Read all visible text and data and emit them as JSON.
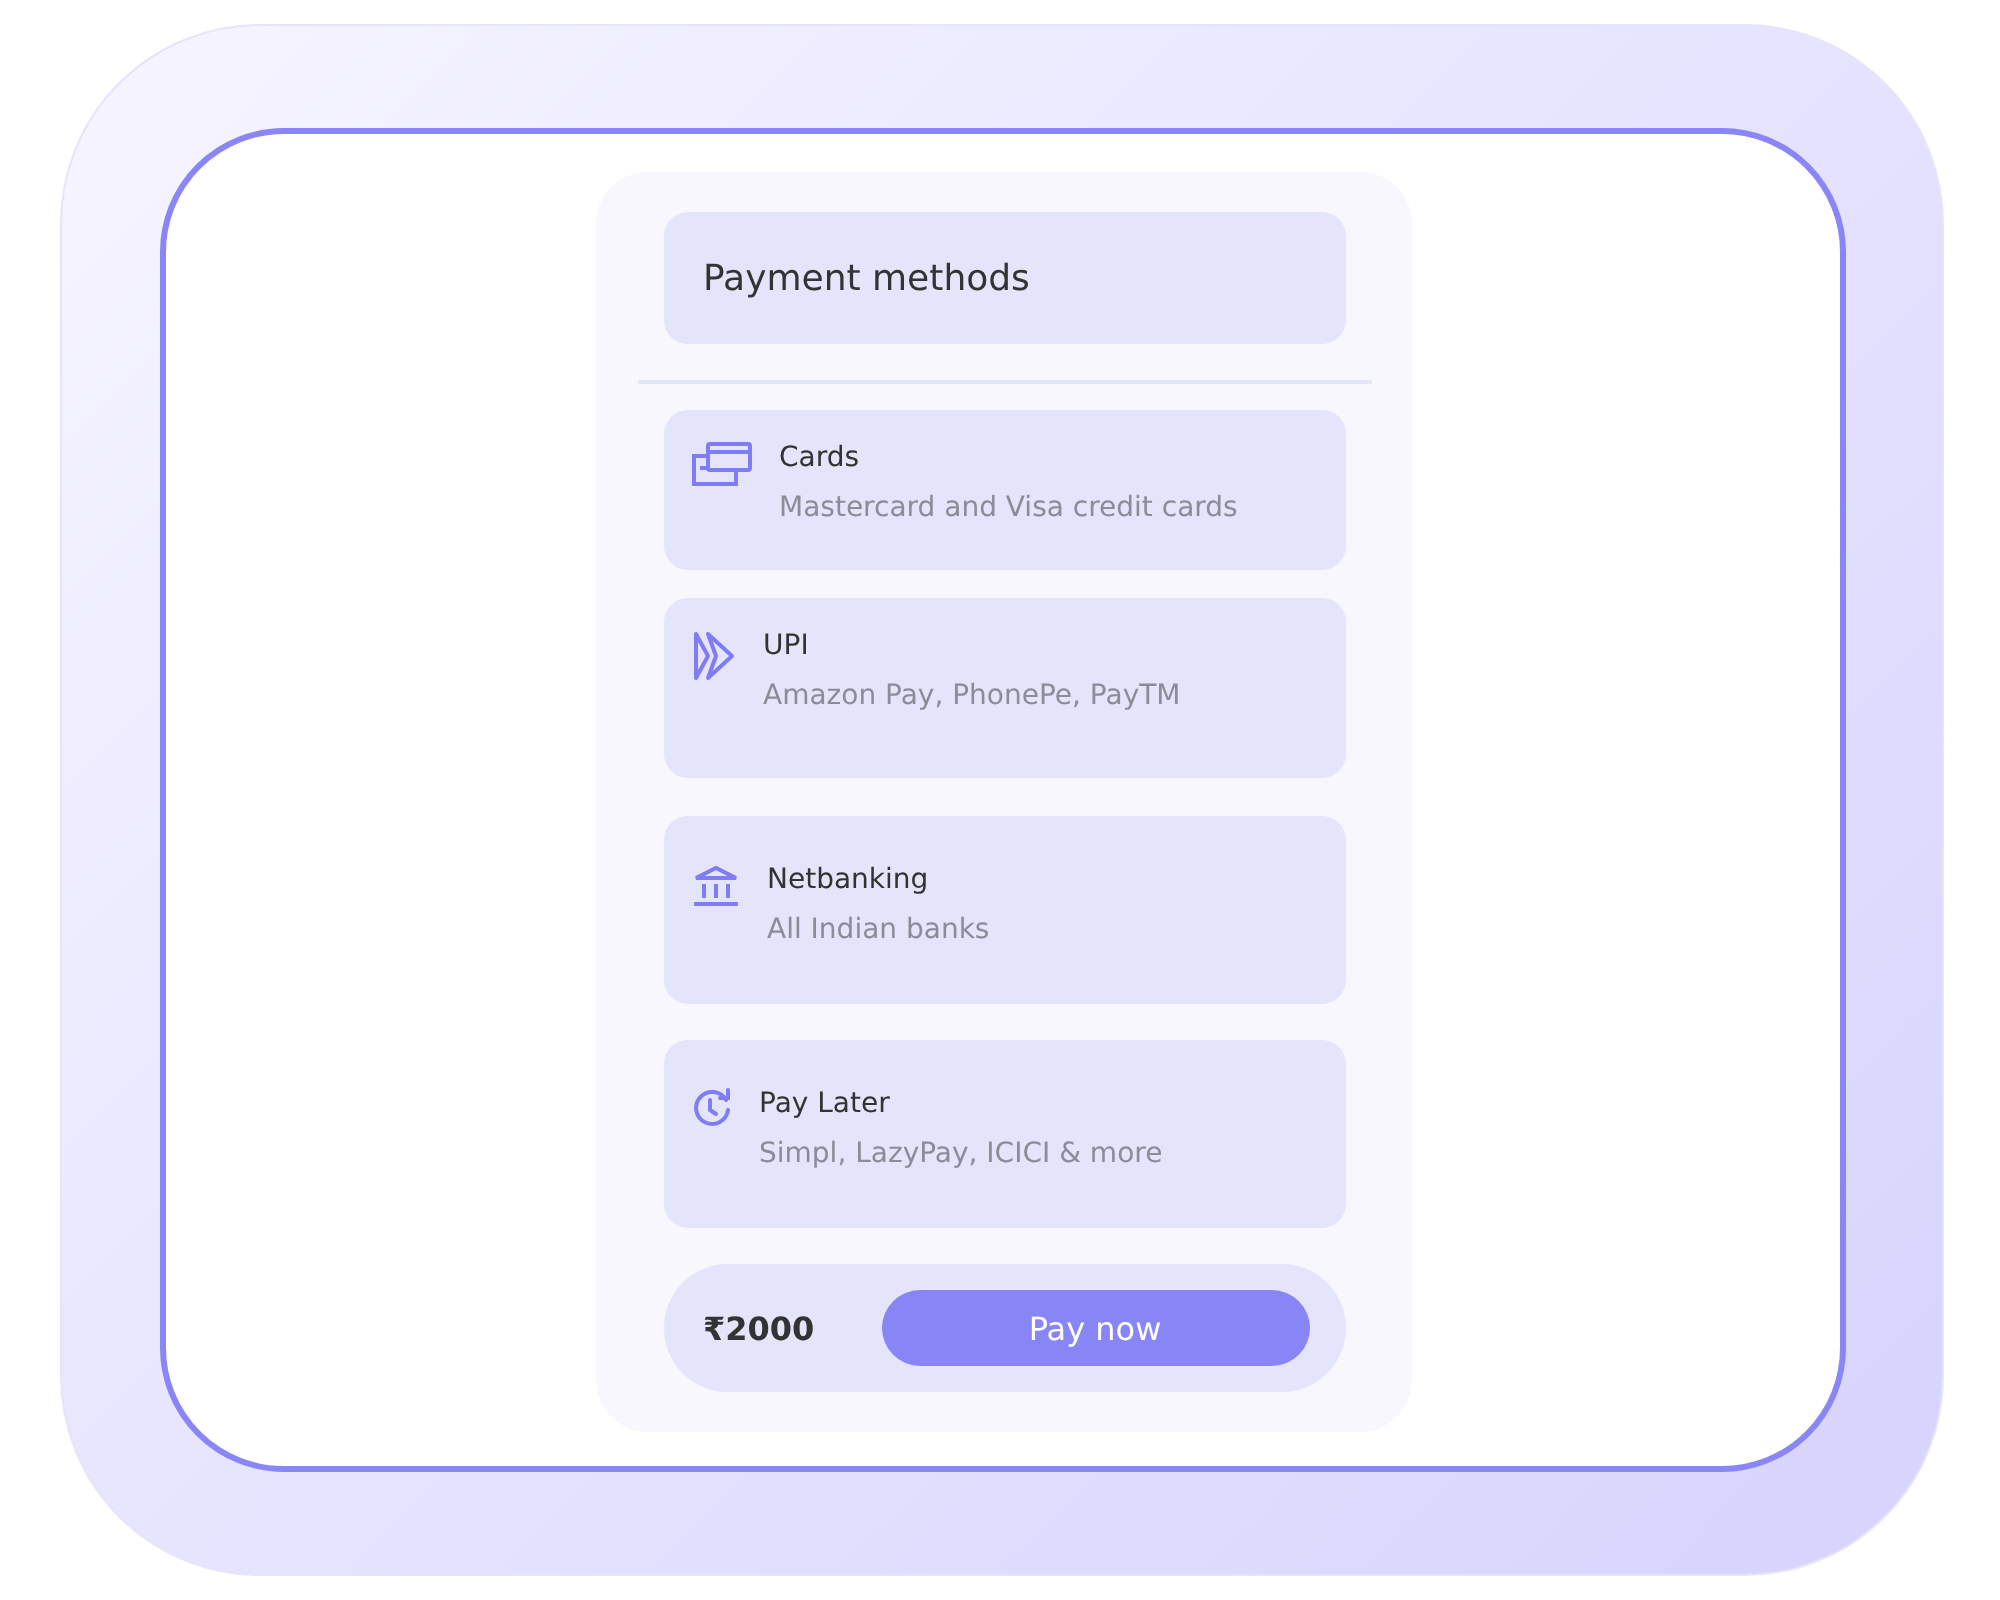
{
  "header": {
    "title": "Payment methods"
  },
  "methods": [
    {
      "kind": "card",
      "title": "Cards",
      "subtitle": "Mastercard and Visa credit cards"
    },
    {
      "kind": "upi",
      "title": "UPI",
      "subtitle": "Amazon Pay, PhonePe, PayTM"
    },
    {
      "kind": "bank",
      "title": "Netbanking",
      "subtitle": "All Indian banks"
    },
    {
      "kind": "later",
      "title": "Pay Later",
      "subtitle": "Simpl, LazyPay, ICICI & more"
    }
  ],
  "footer": {
    "amount": "₹2000",
    "button": "Pay now"
  }
}
